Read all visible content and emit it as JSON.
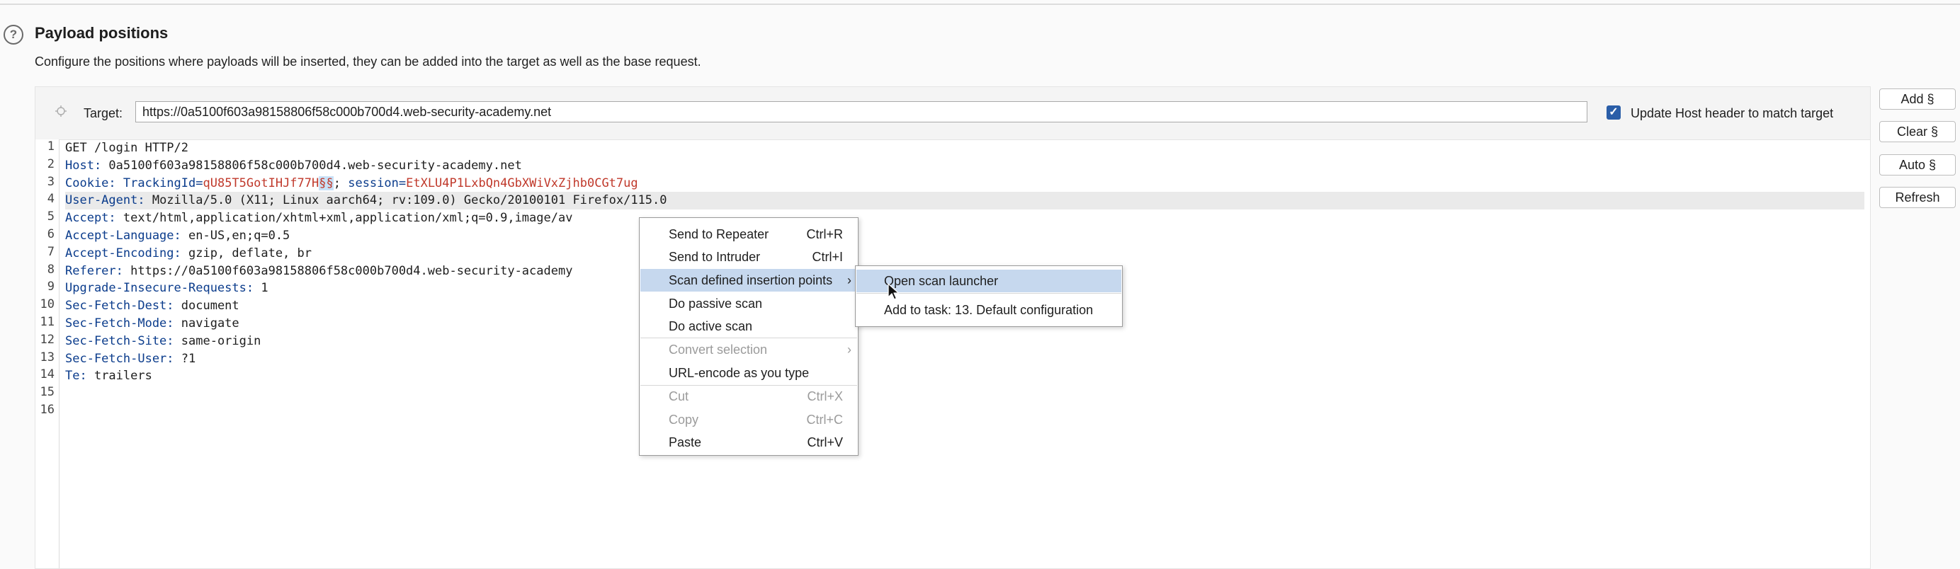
{
  "header": {
    "help_icon_glyph": "?",
    "title": "Payload positions",
    "description": "Configure the positions where payloads will be inserted, they can be added into the target as well as the base request."
  },
  "target": {
    "label": "Target:",
    "url": "https://0a5100f603a98158806f58c000b700d4.web-security-academy.net",
    "update_host_checked": true,
    "update_host_label": "Update Host header to match target"
  },
  "side_buttons": {
    "add": "Add §",
    "clear": "Clear §",
    "auto": "Auto §",
    "refresh": "Refresh"
  },
  "editor": {
    "line_numbers": [
      "1",
      "2",
      "3",
      "4",
      "5",
      "6",
      "7",
      "8",
      "9",
      "10",
      "11",
      "12",
      "13",
      "14",
      "15",
      "16"
    ],
    "lines": {
      "l1": "GET /login HTTP/2",
      "l2_name": "Host:",
      "l2_value": " 0a5100f603a98158806f58c000b700d4.web-security-academy.net",
      "l3_name": "Cookie:",
      "l3_p1_name": " TrackingId=",
      "l3_p1_value": "qU85T5GotIHJf77H",
      "l3_marker": "§§",
      "l3_sep": "; ",
      "l3_p2_name": "session=",
      "l3_p2_value": "EtXLU4P1LxbQn4GbXWiVxZjhb0CGt7ug",
      "l4_name": "User-Agent:",
      "l4_value": " Mozilla/5.0 (X11; Linux aarch64; rv:109.0) Gecko/20100101 Firefox/115.0",
      "l5_name": "Accept:",
      "l5_value": " text/html,application/xhtml+xml,application/xml;q=0.9,image/av",
      "l6_name": "Accept-Language:",
      "l6_value": " en-US,en;q=0.5",
      "l7_name": "Accept-Encoding:",
      "l7_value": " gzip, deflate, br",
      "l8_name": "Referer:",
      "l8_value": " https://0a5100f603a98158806f58c000b700d4.web-security-academy",
      "l9_name": "Upgrade-Insecure-Requests:",
      "l9_value": " 1",
      "l10_name": "Sec-Fetch-Dest:",
      "l10_value": " document",
      "l11_name": "Sec-Fetch-Mode:",
      "l11_value": " navigate",
      "l12_name": "Sec-Fetch-Site:",
      "l12_value": " same-origin",
      "l13_name": "Sec-Fetch-User:",
      "l13_value": " ?1",
      "l14_name": "Te:",
      "l14_value": " trailers"
    }
  },
  "context_menu": {
    "send_to_repeater": {
      "label": "Send to Repeater",
      "shortcut": "Ctrl+R"
    },
    "send_to_intruder": {
      "label": "Send to Intruder",
      "shortcut": "Ctrl+I"
    },
    "scan_defined": {
      "label": "Scan defined insertion points",
      "submenu_glyph": "›"
    },
    "passive_scan": {
      "label": "Do passive scan"
    },
    "active_scan": {
      "label": "Do active scan"
    },
    "convert_selection": {
      "label": "Convert selection",
      "submenu_glyph": "›",
      "enabled": false
    },
    "url_encode": {
      "label": "URL-encode as you type"
    },
    "cut": {
      "label": "Cut",
      "shortcut": "Ctrl+X",
      "enabled": false
    },
    "copy": {
      "label": "Copy",
      "shortcut": "Ctrl+C",
      "enabled": false
    },
    "paste": {
      "label": "Paste",
      "shortcut": "Ctrl+V"
    }
  },
  "submenu": {
    "open_scan_launcher": "Open scan launcher",
    "add_to_task": "Add to task: 13. Default configuration"
  },
  "colors": {
    "header_name": "#0b3c8c",
    "param_value": "#c0392b",
    "selection": "#c6d8ee",
    "checkbox": "#2a5ea8"
  }
}
